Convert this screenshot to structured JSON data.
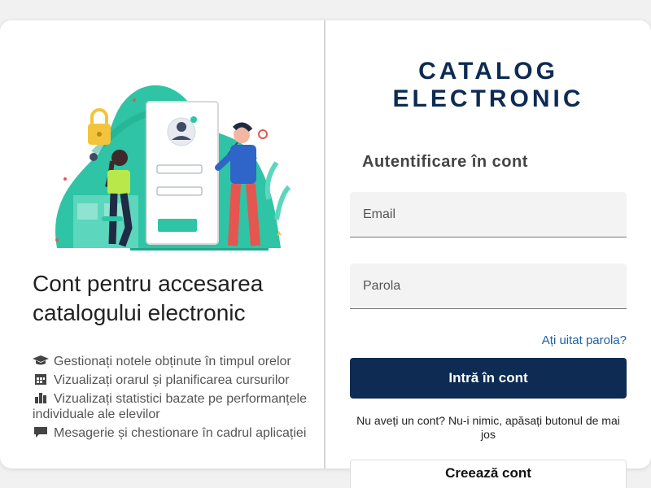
{
  "left_panel": {
    "headline": "Cont pentru accesarea catalogului electronic",
    "features": [
      {
        "icon": "graduation-cap-icon",
        "text": "Gestionați notele obținute în timpul orelor"
      },
      {
        "icon": "calendar-icon",
        "text": "Vizualizați orarul și planificarea cursurilor"
      },
      {
        "icon": "bar-chart-icon",
        "text": "Vizualizați statistici bazate pe performanțele individuale ale elevilor"
      },
      {
        "icon": "comment-icon",
        "text": "Mesagerie și chestionare în cadrul aplicației"
      }
    ]
  },
  "right_panel": {
    "brand_line1": "CATALOG",
    "brand_line2": "ELECTRONIC",
    "auth_title": "Autentificare în cont",
    "email_placeholder": "Email",
    "password_placeholder": "Parola",
    "forgot_password": "Ați uitat parola?",
    "login_button": "Intră în cont",
    "no_account_text": "Nu aveți un cont? Nu-i nimic, apăsați butonul de mai jos",
    "create_account_button": "Creează cont"
  },
  "colors": {
    "brand_navy": "#0d2b53",
    "link_blue": "#1d5fa8",
    "illustration_teal": "#2ec4a5",
    "accent_yellow": "#f3c43b"
  }
}
